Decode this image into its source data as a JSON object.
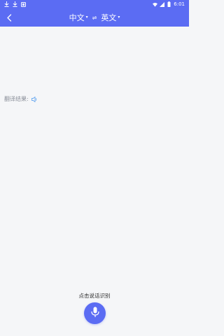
{
  "status_bar": {
    "time": "6:01",
    "icons": [
      "download-icon",
      "download-icon",
      "notification-icon",
      "wifi-icon",
      "signal-icon",
      "battery-icon"
    ]
  },
  "nav": {
    "back_icon": "back-arrow-icon",
    "source_lang": "中文",
    "target_lang": "英文",
    "swap_symbol": "⇌",
    "caret_symbol": "▾"
  },
  "result": {
    "label": "翻译结果:"
  },
  "voice": {
    "hint": "点击说话识别",
    "mic_icon": "microphone-icon"
  },
  "colors": {
    "primary": "#5b6cf3",
    "background": "#f5f6f8",
    "muted_text": "#8a8f99"
  }
}
